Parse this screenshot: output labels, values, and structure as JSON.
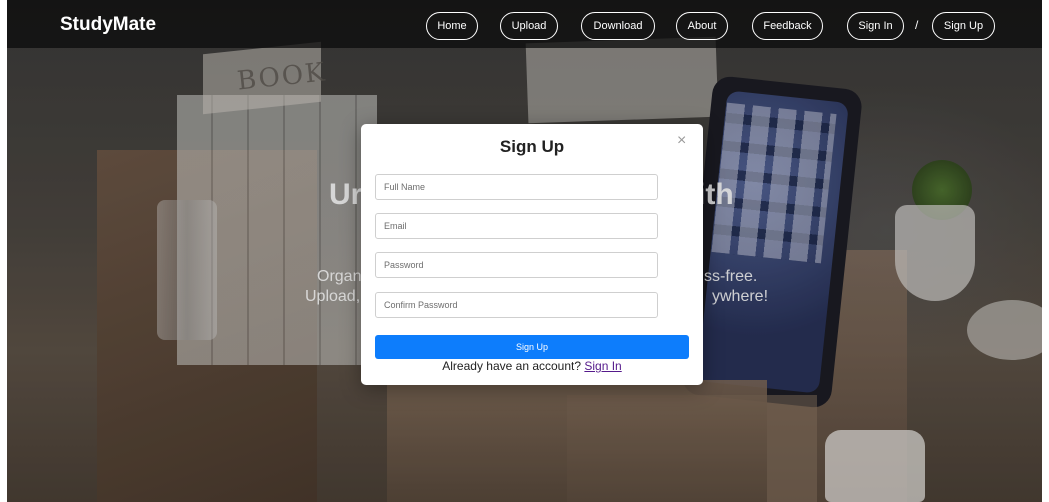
{
  "nav": {
    "brand": "StudyMate",
    "links": [
      "Home",
      "Upload",
      "Download",
      "About",
      "Feedback",
      "Sign In",
      "Sign Up"
    ],
    "separator": "/"
  },
  "hero": {
    "title_left": "Ur",
    "title_right": "ith",
    "line1_left": "Organiz",
    "line1_right": "ss-free.",
    "line2_left": "Upload,",
    "line2_right": "ywhere!"
  },
  "background": {
    "box_label": "BOOK"
  },
  "modal": {
    "title": "Sign Up",
    "close_symbol": "×",
    "fields": [
      {
        "placeholder": "Full Name"
      },
      {
        "placeholder": "Email"
      },
      {
        "placeholder": "Password"
      },
      {
        "placeholder": "Confirm Password"
      }
    ],
    "submit_label": "Sign Up",
    "switch_text": "Already have an account?",
    "switch_link": "Sign In"
  },
  "colors": {
    "primary_button": "#0d7dfc",
    "link": "#551a8b",
    "navbar": "#0a0a0a"
  }
}
